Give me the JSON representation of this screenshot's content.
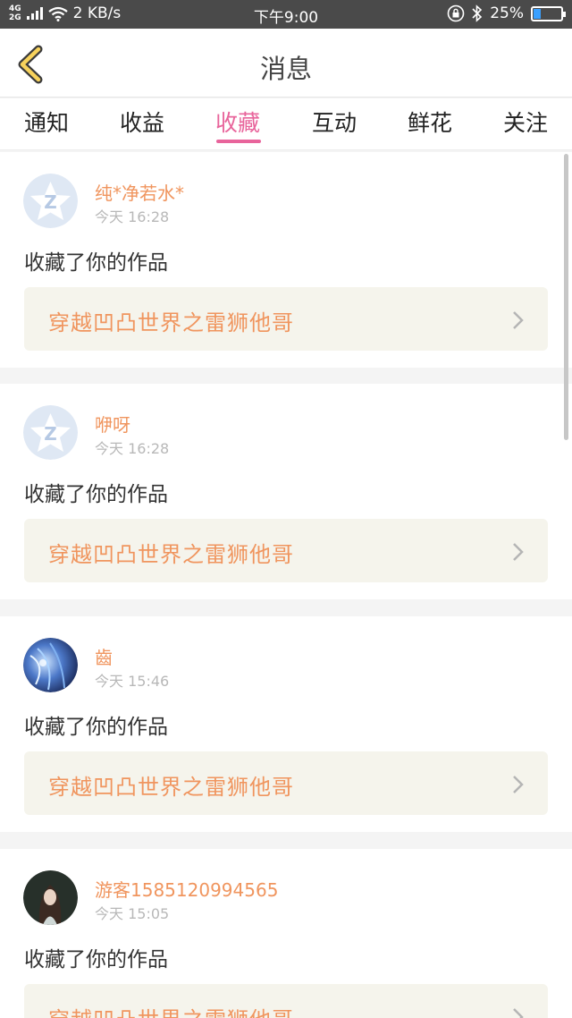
{
  "status_bar": {
    "network": "4G\n2G",
    "speed": "2 KB/s",
    "time": "下午9:00",
    "battery": "25%",
    "battery_level": 0.25
  },
  "header": {
    "title": "消息"
  },
  "tabs": [
    {
      "label": "通知"
    },
    {
      "label": "收益"
    },
    {
      "label": "收藏"
    },
    {
      "label": "互动"
    },
    {
      "label": "鲜花"
    },
    {
      "label": "关注"
    }
  ],
  "active_tab": "收藏",
  "colors": {
    "accent": "#e8649b",
    "name": "#f0955e",
    "status_bg": "#4a4a4a"
  },
  "messages": [
    {
      "user": "纯*净若水*",
      "time": "今天 16:28",
      "action": "收藏了你的作品",
      "work": "穿越凹凸世界之雷狮他哥",
      "avatar": "default-star-avatar"
    },
    {
      "user": "咿呀",
      "time": "今天 16:28",
      "action": "收藏了你的作品",
      "work": "穿越凹凸世界之雷狮他哥",
      "avatar": "default-star-avatar"
    },
    {
      "user": "齒",
      "time": "今天 15:46",
      "action": "收藏了你的作品",
      "work": "穿越凹凸世界之雷狮他哥",
      "avatar": "anime-avatar-blue"
    },
    {
      "user": "游客1585120994565",
      "time": "今天 15:05",
      "action": "收藏了你的作品",
      "work": "穿越凹凸世界之雷狮他哥",
      "avatar": "anime-avatar-girl"
    }
  ]
}
